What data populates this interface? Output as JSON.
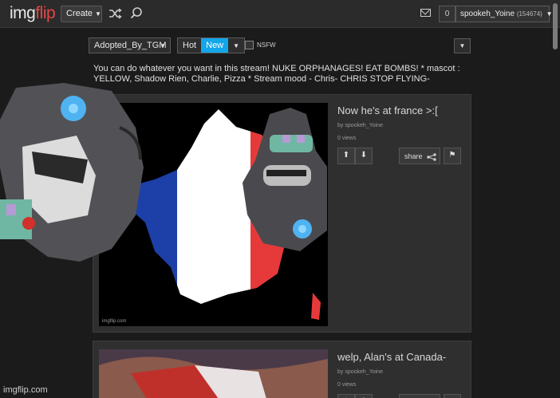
{
  "header": {
    "logo_main": "img",
    "logo_accent": "flip",
    "create_label": "Create",
    "notification_count": "0",
    "username": "spookeh_Yoine",
    "user_points": "(154674)",
    "colors": {
      "accent_red": "#e64545",
      "active_blue": "#13a6e8"
    }
  },
  "stream": {
    "selected_stream": "Adopted_By_TGM",
    "sort_hot": "Hot",
    "sort_new": "New",
    "active_sort": "New",
    "nsfw_label": "NSFW",
    "description": "You can do whatever you want in this stream! NUKE ORPHANAGES! EAT BOMBS! * mascot : YELLOW, Shadow Rien, Charlie, Pizza * Stream mood - Chris- CHRIS STOP FLYING-"
  },
  "posts": [
    {
      "title": "Now he's at france >:[",
      "author": "by spookeh_Yoine",
      "views": "0 views",
      "share_label": "share",
      "image_watermark": "imgflip.com"
    },
    {
      "title": "welp, Alan's at Canada-",
      "author": "by spookeh_Yoine",
      "views": "0 views"
    }
  ],
  "footer": {
    "watermark": "imgflip.com"
  },
  "icons": [
    "caret-down-icon",
    "shuffle-icon",
    "search-icon",
    "mail-icon",
    "upvote-icon",
    "downvote-icon",
    "share-icon",
    "flag-icon"
  ]
}
